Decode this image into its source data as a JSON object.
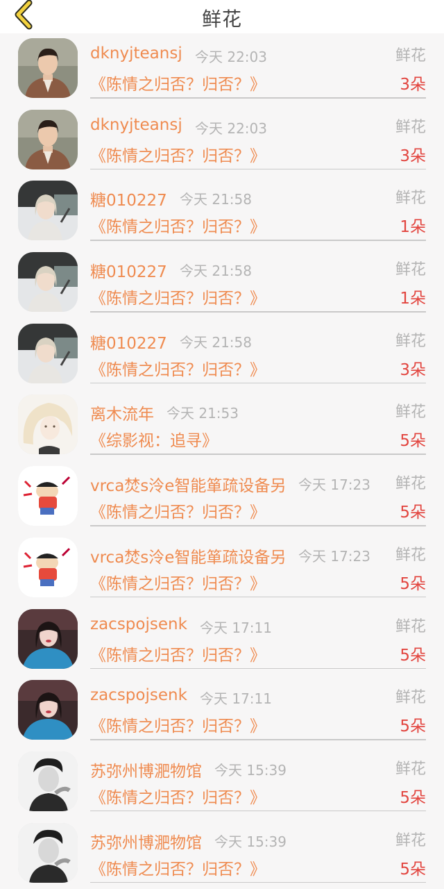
{
  "header": {
    "title": "鲜花"
  },
  "colors": {
    "accent": "#ef8b50",
    "count": "#e2443e",
    "muted": "#b4b4b4"
  },
  "items": [
    {
      "user": "dknyjteansj",
      "time": "今天 22:03",
      "gift": "鲜花",
      "book": "《陈情之归否？归否？》",
      "count": "3朵",
      "avatar": "avatar-girl-coat"
    },
    {
      "user": "dknyjteansj",
      "time": "今天 22:03",
      "gift": "鲜花",
      "book": "《陈情之归否？归否？》",
      "count": "3朵",
      "avatar": "avatar-girl-coat"
    },
    {
      "user": "糖010227",
      "time": "今天 21:58",
      "gift": "鲜花",
      "book": "《陈情之归否？归否？》",
      "count": "1朵",
      "avatar": "avatar-girl-blonde"
    },
    {
      "user": "糖010227",
      "time": "今天 21:58",
      "gift": "鲜花",
      "book": "《陈情之归否？归否？》",
      "count": "1朵",
      "avatar": "avatar-girl-blonde"
    },
    {
      "user": "糖010227",
      "time": "今天 21:58",
      "gift": "鲜花",
      "book": "《陈情之归否？归否？》",
      "count": "3朵",
      "avatar": "avatar-girl-blonde"
    },
    {
      "user": "离木流年",
      "time": "今天 21:53",
      "gift": "鲜花",
      "book": "《综影视：追寻》",
      "count": "5朵",
      "avatar": "avatar-drawn-girl"
    },
    {
      "user": "vrca焚s泠e智能箪疏设备另",
      "time": "今天 17:23",
      "gift": "鲜花",
      "book": "《陈情之归否？归否？》",
      "count": "5朵",
      "avatar": "avatar-cartoon-boy"
    },
    {
      "user": "vrca焚s泠e智能箪疏设备另",
      "time": "今天 17:23",
      "gift": "鲜花",
      "book": "《陈情之归否？归否？》",
      "count": "5朵",
      "avatar": "avatar-cartoon-boy"
    },
    {
      "user": "zacspojsenk",
      "time": "今天 17:11",
      "gift": "鲜花",
      "book": "《陈情之归否？归否？》",
      "count": "5朵",
      "avatar": "avatar-girl-blue"
    },
    {
      "user": "zacspojsenk",
      "time": "今天 17:11",
      "gift": "鲜花",
      "book": "《陈情之归否？归否？》",
      "count": "5朵",
      "avatar": "avatar-girl-blue"
    },
    {
      "user": "苏弥州博淝物馆",
      "time": "今天 15:39",
      "gift": "鲜花",
      "book": "《陈情之归否？归否？》",
      "count": "5朵",
      "avatar": "avatar-man-bw"
    },
    {
      "user": "苏弥州博淝物馆",
      "time": "今天 15:39",
      "gift": "鲜花",
      "book": "《陈情之归否？归否？》",
      "count": "5朵",
      "avatar": "avatar-man-bw"
    }
  ]
}
